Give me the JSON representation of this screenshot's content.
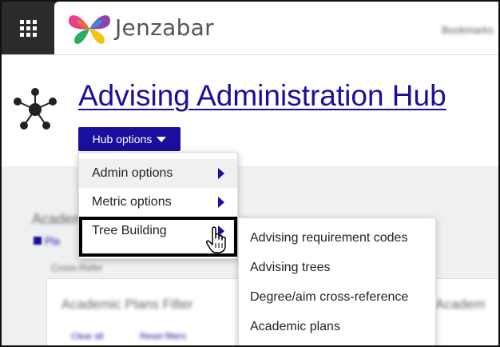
{
  "app": {
    "brand_name": "Jenzabar",
    "header_right_text": "Bookmarks",
    "apps_icon": "apps-grid-icon",
    "logo_icon": "butterfly-logo-icon"
  },
  "hub": {
    "title": "Advising Administration Hub",
    "options_label": "Hub options",
    "icon": "hub-network-icon"
  },
  "menu": {
    "items": [
      {
        "label": "Admin options"
      },
      {
        "label": "Metric options"
      },
      {
        "label": "Tree Building"
      }
    ]
  },
  "submenu": {
    "items": [
      {
        "label": "Advising requirement codes"
      },
      {
        "label": "Advising trees"
      },
      {
        "label": "Degree/aim cross-reference"
      },
      {
        "label": "Academic plans"
      }
    ]
  },
  "background": {
    "section_title": "Academic",
    "link_text": "Pla",
    "sub_text": "Cross-Refer",
    "panel_title": "Academic Plans Filter",
    "clear_label": "Clear all",
    "reset_label": "Reset filters",
    "right_text": "Academ"
  },
  "colors": {
    "accent": "#1a0f9c",
    "topbar": "#2b2b2b",
    "content_bg": "#eef0f2"
  }
}
